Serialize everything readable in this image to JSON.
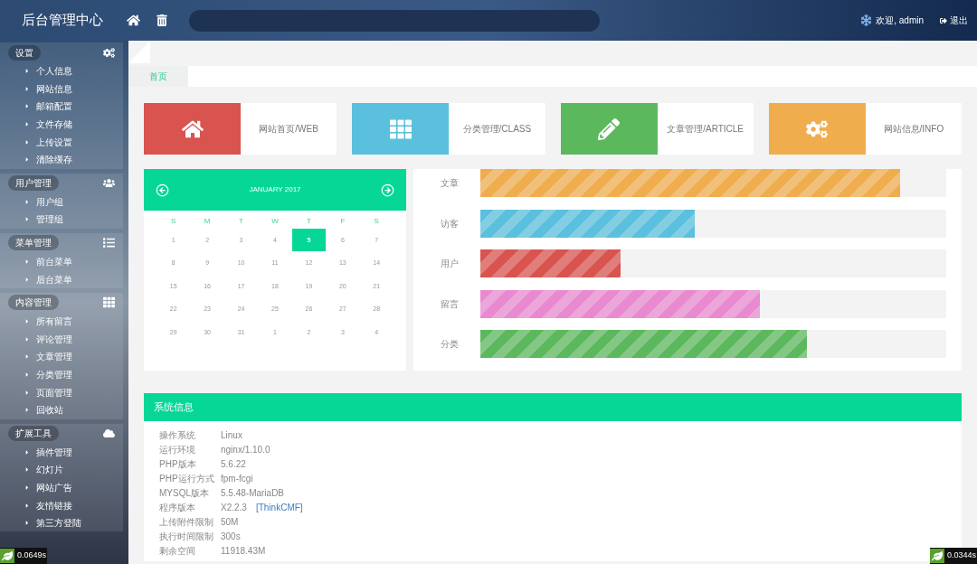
{
  "header": {
    "title": "后台管理中心",
    "welcome": "欢迎, admin",
    "logout": "退出"
  },
  "sidebar": [
    {
      "title": "设置",
      "items": [
        "个人信息",
        "网站信息",
        "邮箱配置",
        "文件存储",
        "上传设置",
        "清除缓存"
      ]
    },
    {
      "title": "用户管理",
      "items": [
        "用户组",
        "管理组"
      ]
    },
    {
      "title": "菜单管理",
      "items": [
        "前台菜单",
        "后台菜单"
      ]
    },
    {
      "title": "内容管理",
      "items": [
        "所有留言",
        "评论管理",
        "文章管理",
        "分类管理",
        "页面管理",
        "回收站"
      ]
    },
    {
      "title": "扩展工具",
      "items": [
        "插件管理",
        "幻灯片",
        "网站广告",
        "友情链接",
        "第三方登陆"
      ]
    }
  ],
  "tabs": [
    {
      "label": "首页",
      "selected": true
    }
  ],
  "quick_links": [
    {
      "label": "网站首页/WEB",
      "color": "#d9534f"
    },
    {
      "label": "分类管理/CLASS",
      "color": "#5bc0de"
    },
    {
      "label": "文章管理/ARTICLE",
      "color": "#5cb85c"
    },
    {
      "label": "网站信息/INFO",
      "color": "#f0ad4e"
    }
  ],
  "calendar": {
    "month": "JANUARY 2017",
    "weekdays": [
      "S",
      "M",
      "T",
      "W",
      "T",
      "F",
      "S"
    ],
    "days": [
      {
        "label": "1",
        "selected": false
      },
      {
        "label": "2",
        "selected": false
      },
      {
        "label": "3",
        "selected": false
      },
      {
        "label": "4",
        "selected": false
      },
      {
        "label": "5",
        "selected": true
      },
      {
        "label": "6",
        "selected": false
      },
      {
        "label": "7",
        "selected": false
      },
      {
        "label": "8",
        "selected": false
      },
      {
        "label": "9",
        "selected": false
      },
      {
        "label": "10",
        "selected": false
      },
      {
        "label": "11",
        "selected": false
      },
      {
        "label": "12",
        "selected": false
      },
      {
        "label": "13",
        "selected": false
      },
      {
        "label": "14",
        "selected": false
      },
      {
        "label": "15",
        "selected": false
      },
      {
        "label": "16",
        "selected": false
      },
      {
        "label": "17",
        "selected": false
      },
      {
        "label": "18",
        "selected": false
      },
      {
        "label": "19",
        "selected": false
      },
      {
        "label": "20",
        "selected": false
      },
      {
        "label": "21",
        "selected": false
      },
      {
        "label": "22",
        "selected": false
      },
      {
        "label": "23",
        "selected": false
      },
      {
        "label": "24",
        "selected": false
      },
      {
        "label": "25",
        "selected": false
      },
      {
        "label": "26",
        "selected": false
      },
      {
        "label": "27",
        "selected": false
      },
      {
        "label": "28",
        "selected": false
      },
      {
        "label": "29",
        "selected": false
      },
      {
        "label": "30",
        "selected": false
      },
      {
        "label": "31",
        "selected": false
      },
      {
        "label": "1",
        "selected": false
      },
      {
        "label": "2",
        "selected": false
      },
      {
        "label": "3",
        "selected": false
      },
      {
        "label": "4",
        "selected": false
      }
    ]
  },
  "stats": [
    {
      "label": "文章",
      "level": 0.9,
      "color": "#f0ad4e"
    },
    {
      "label": "访客",
      "level": 0.46,
      "color": "#5bc0de"
    },
    {
      "label": "用户",
      "level": 0.3,
      "color": "#d9534f"
    },
    {
      "label": "留言",
      "level": 0.6,
      "color": "#e98ad0"
    },
    {
      "label": "分类",
      "level": 0.7,
      "color": "#5cb85c"
    }
  ],
  "system_info": {
    "title": "系统信息",
    "rows": [
      {
        "label": "操作系统",
        "value": "Linux"
      },
      {
        "label": "运行环境",
        "value": "nginx/1.10.0"
      },
      {
        "label": "PHP版本",
        "value": "5.6.22"
      },
      {
        "label": "PHP运行方式",
        "value": "fpm-fcgi"
      },
      {
        "label": "MYSQL版本",
        "value": "5.5.48-MariaDB"
      },
      {
        "label": "程序版本",
        "value": "X2.2.3",
        "link": "[ThinkCMF]"
      },
      {
        "label": "上传附件限制",
        "value": "50M"
      },
      {
        "label": "执行时间限制",
        "value": "300s"
      },
      {
        "label": "剩余空间",
        "value": "11918.43M"
      }
    ]
  },
  "timers": [
    "0.0649s",
    "0.0344s"
  ]
}
